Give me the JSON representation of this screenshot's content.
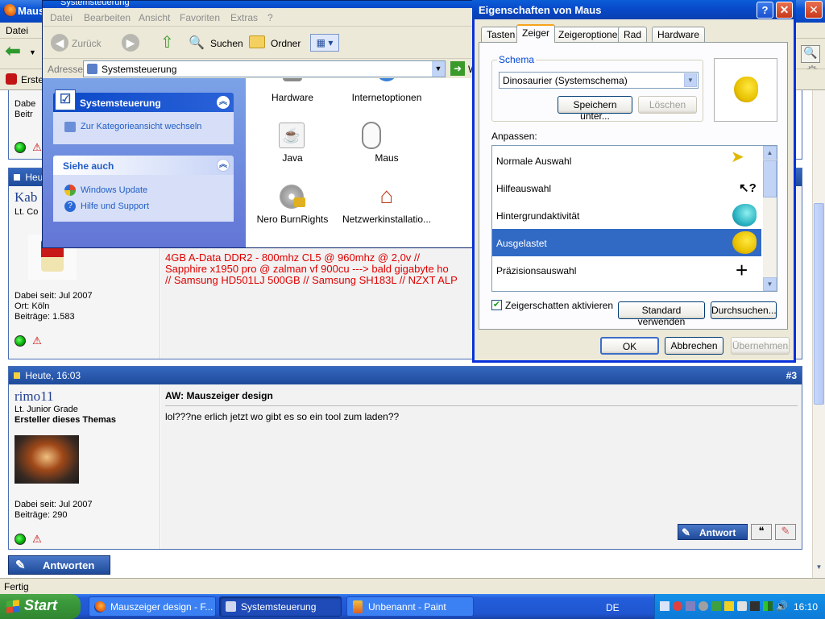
{
  "firefox": {
    "title": "Maus",
    "menu_file": "Datei",
    "status": "Fertig",
    "bookmark_first": "Erste"
  },
  "explorer": {
    "title": "Systemsteuerung",
    "menu": [
      "Datei",
      "Bearbeiten",
      "Ansicht",
      "Favoriten",
      "Extras",
      "?"
    ],
    "back_label": "Zurück",
    "search_label": "Suchen",
    "folder_label": "Ordner",
    "address_label": "Adresse",
    "address_value": "Systemsteuerung",
    "go_label": "W",
    "panel1_title": "Systemsteuerung",
    "panel1_link": "Zur Kategorieansicht wechseln",
    "panel2_title": "Siehe auch",
    "panel2_links": [
      "Windows Update",
      "Hilfe und Support"
    ],
    "icons": [
      "Hardware",
      "Internetoptionen",
      "Java",
      "Maus",
      "Nero BurnRights",
      "Netzwerkinstallatio..."
    ]
  },
  "forum": {
    "post2": {
      "date": "Heut",
      "user": "Kab",
      "rank": "Lt. Co",
      "joined": "Dabei seit: Jul 2007",
      "location": "Ort: Köln",
      "posts": "Beiträge: 1.583",
      "sig_lines": [
        "4GB A-Data DDR2 - 800mhz CL5 @ 960mhz @ 2,0v //",
        "Sapphire x1950 pro @ zalman vf 900cu ---> bald gigabyte ho",
        "// Samsung HD501LJ 500GB // Samsung SH183L // NZXT ALP"
      ]
    },
    "post1_fragment": {
      "joined": "Dabe",
      "posts": "Beitr"
    },
    "post3": {
      "date": "Heute, 16:03",
      "number": "#3",
      "user": "rimo11",
      "rank": "Lt. Junior Grade",
      "starter": "Ersteller dieses Themas",
      "joined": "Dabei seit: Jul 2007",
      "posts": "Beiträge: 290",
      "subject": "AW: Mauszeiger design",
      "body": "lol???ne erlich jetzt wo gibt es so ein tool zum laden??",
      "reply_label": "Antwort"
    },
    "reply_main_label": "Antworten"
  },
  "dialog": {
    "title": "Eigenschaften von Maus",
    "tabs": [
      "Tasten",
      "Zeiger",
      "Zeigeroptionen",
      "Rad",
      "Hardware"
    ],
    "scheme_group": "Schema",
    "scheme_value": "Dinosaurier (Systemschema)",
    "save_as": "Speichern unter...",
    "delete": "Löschen",
    "customize_label": "Anpassen:",
    "list": [
      {
        "label": "Normale Auswahl",
        "icon": "arrow-cursor-icon"
      },
      {
        "label": "Hilfeauswahl",
        "icon": "help-cursor-icon"
      },
      {
        "label": "Hintergrundaktivität",
        "icon": "dino-working-icon"
      },
      {
        "label": "Ausgelastet",
        "icon": "dino-busy-icon"
      },
      {
        "label": "Präzisionsauswahl",
        "icon": "crosshair-icon"
      }
    ],
    "shadow_checkbox": "Zeigerschatten aktivieren",
    "shadow_checked": true,
    "default_btn": "Standard verwenden",
    "browse_btn": "Durchsuchen...",
    "ok": "OK",
    "cancel": "Abbrechen",
    "apply": "Übernehmen"
  },
  "taskbar": {
    "start": "Start",
    "tasks": [
      "Mauszeiger design - F...",
      "Systemsteuerung",
      "Unbenannt - Paint"
    ],
    "lang": "DE",
    "clock": "16:10"
  },
  "colors": {
    "xp_blue": "#245edb",
    "selection": "#316ac5",
    "forum_red": "#e00000",
    "post_header": "#2a58aa"
  }
}
